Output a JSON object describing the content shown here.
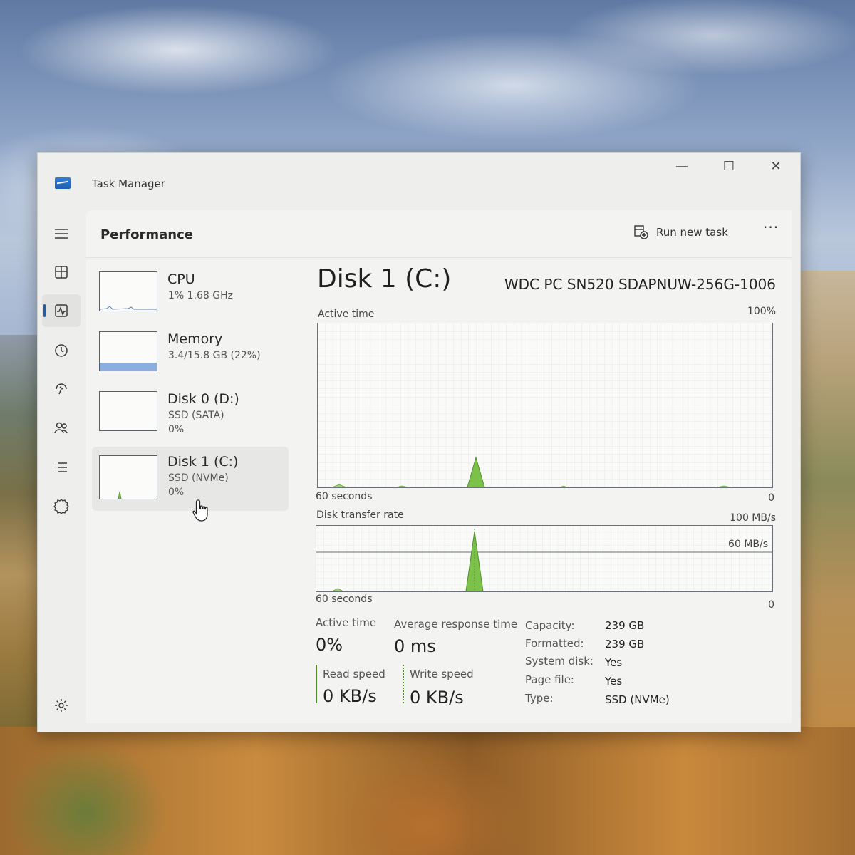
{
  "window": {
    "title": "Task Manager",
    "controls": {
      "minimize": "—",
      "maximize": "☐",
      "close": "✕"
    }
  },
  "header": {
    "title": "Performance",
    "run_new_task": "Run new task",
    "more": "···"
  },
  "devices": [
    {
      "name": "CPU",
      "line1": "1% 1.68 GHz",
      "line2": ""
    },
    {
      "name": "Memory",
      "line1": "3.4/15.8 GB (22%)",
      "line2": ""
    },
    {
      "name": "Disk 0 (D:)",
      "line1": "SSD (SATA)",
      "line2": "0%"
    },
    {
      "name": "Disk 1 (C:)",
      "line1": "SSD (NVMe)",
      "line2": "0%"
    }
  ],
  "memory_thumb_fill": 0.22,
  "detail": {
    "title": "Disk 1 (C:)",
    "model": "WDC PC SN520 SDAPNUW-256G-1006",
    "active_graph": {
      "label": "Active time",
      "max": "100%",
      "time": "60 seconds",
      "min": "0"
    },
    "transfer_graph": {
      "label": "Disk transfer rate",
      "max": "100 MB/s",
      "line": "60 MB/s",
      "time": "60 seconds",
      "min": "0"
    },
    "stats": {
      "active_time_label": "Active time",
      "active_time_value": "0%",
      "avg_resp_label": "Average response time",
      "avg_resp_value": "0 ms",
      "read_label": "Read speed",
      "read_value": "0 KB/s",
      "write_label": "Write speed",
      "write_value": "0 KB/s"
    },
    "props": [
      {
        "key": "Capacity:",
        "value": "239 GB"
      },
      {
        "key": "Formatted:",
        "value": "239 GB"
      },
      {
        "key": "System disk:",
        "value": "Yes"
      },
      {
        "key": "Page file:",
        "value": "Yes"
      },
      {
        "key": "Type:",
        "value": "SSD (NVMe)"
      }
    ]
  },
  "colors": {
    "accent": "#1a5fb4",
    "disk_green": "#7cc24a",
    "memory_blue": "#8aaee0"
  }
}
